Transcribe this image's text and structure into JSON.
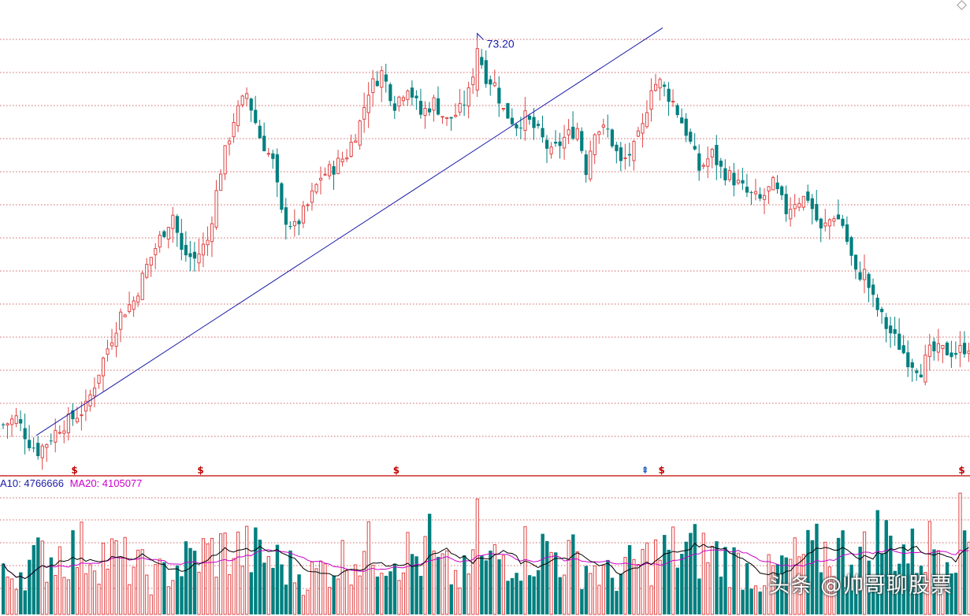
{
  "chart_data": {
    "type": "candlestick",
    "price_axis": {
      "ylim": [
        48.5,
        74.5
      ],
      "grid": "dotted-horizontal"
    },
    "peak_label": "73.20",
    "markers": [
      {
        "index": 16,
        "symbol": "$"
      },
      {
        "index": 45,
        "symbol": "$"
      },
      {
        "index": 90,
        "symbol": "$"
      },
      {
        "index": 147,
        "symbol": "⇞"
      },
      {
        "index": 151,
        "symbol": "$"
      },
      {
        "index": 220,
        "symbol": "$"
      }
    ],
    "volume_legend": {
      "ma10_label": "A10: 4766666",
      "ma20_label": "MA20: 4105077"
    },
    "colors": {
      "up": "#e04545",
      "down": "#007f7f",
      "grid": "#c83232",
      "divider": "#c00000",
      "trendline": "#1a1aa8",
      "ma10": "#000000",
      "ma20": "#cc00cc",
      "marker": "#c00000",
      "marker_alt": "#1f5fbf"
    },
    "trendline_points": [
      [
        8,
        50.2
      ],
      [
        152,
        73.8
      ]
    ],
    "candles": [],
    "volume": []
  },
  "watermark": "头条 @帅哥聊股票"
}
